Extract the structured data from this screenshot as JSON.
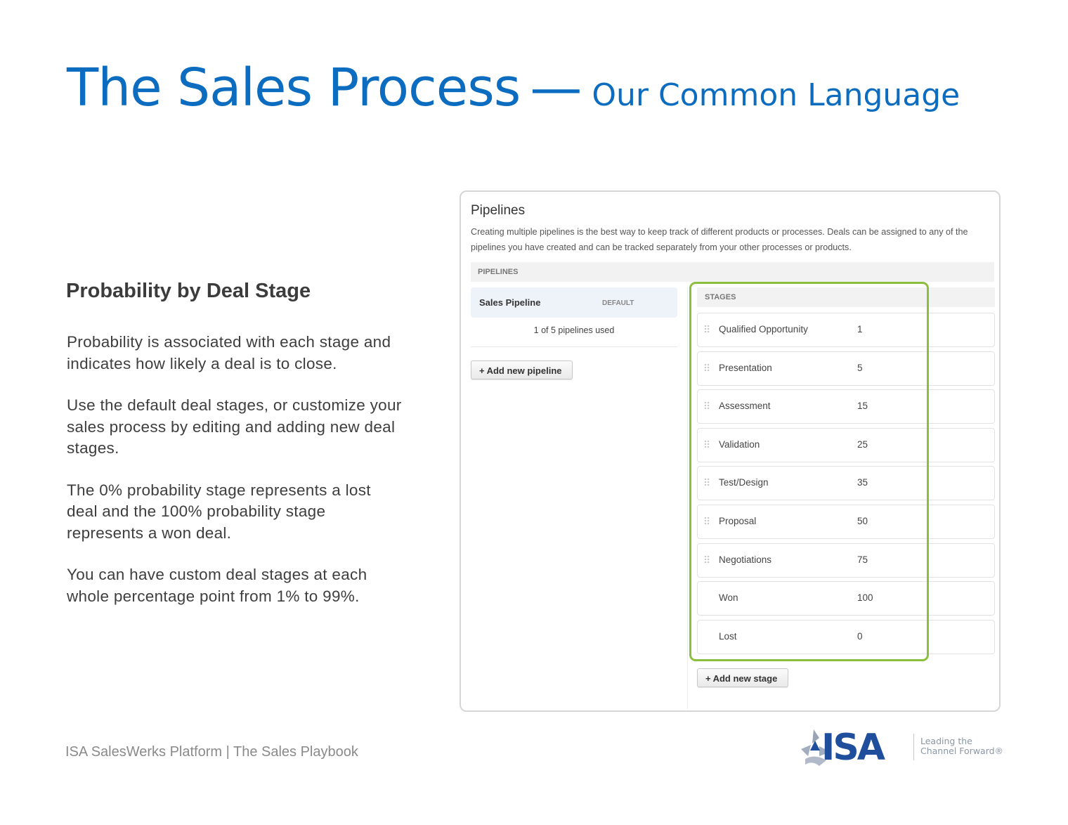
{
  "slide": {
    "title_main": "The Sales Process",
    "title_dash": "—",
    "title_sub": "Our Common Language",
    "section_heading": "Probability by Deal Stage",
    "paragraphs": [
      "Probability is associated with each stage and indicates how likely a deal is to close.",
      "Use the default deal stages, or customize your sales process by editing and adding new deal stages.",
      "The 0% probability stage represents a lost deal and the 100% probability stage represents a won deal.",
      "You can have custom deal stages at each whole percentage point from 1% to 99%."
    ],
    "footer": "ISA SalesWerks Platform | The Sales Playbook"
  },
  "panel": {
    "title": "Pipelines",
    "description": "Creating multiple pipelines is the best way to keep track of different products or processes. Deals can be assigned to any of the pipelines you have created and can be tracked separately from your other processes or products.",
    "pipelines_header": "PIPELINES",
    "pipeline": {
      "name": "Sales Pipeline",
      "badge": "DEFAULT"
    },
    "pipelines_used": "1 of 5 pipelines used",
    "add_pipeline_label": "Add new pipeline",
    "stages_header": "STAGES",
    "stages": [
      {
        "name": "Qualified Opportunity",
        "probability": "1",
        "draggable": true
      },
      {
        "name": "Presentation",
        "probability": "5",
        "draggable": true
      },
      {
        "name": "Assessment",
        "probability": "15",
        "draggable": true
      },
      {
        "name": "Validation",
        "probability": "25",
        "draggable": true
      },
      {
        "name": "Test/Design",
        "probability": "35",
        "draggable": true
      },
      {
        "name": "Proposal",
        "probability": "50",
        "draggable": true
      },
      {
        "name": "Negotiations",
        "probability": "75",
        "draggable": true
      },
      {
        "name": "Won",
        "probability": "100",
        "draggable": false
      },
      {
        "name": "Lost",
        "probability": "0",
        "draggable": false
      }
    ],
    "add_stage_label": "Add new stage",
    "plus_icon": "+",
    "highlight_color": "#8cbf3f"
  },
  "logo": {
    "wordmark": "ISA",
    "tagline_line1": "Leading the",
    "tagline_line2": "Channel Forward®"
  },
  "colors": {
    "title_blue": "#0c6cbf",
    "logo_blue": "#1f4f9c",
    "highlight_green": "#8cbf3f"
  }
}
